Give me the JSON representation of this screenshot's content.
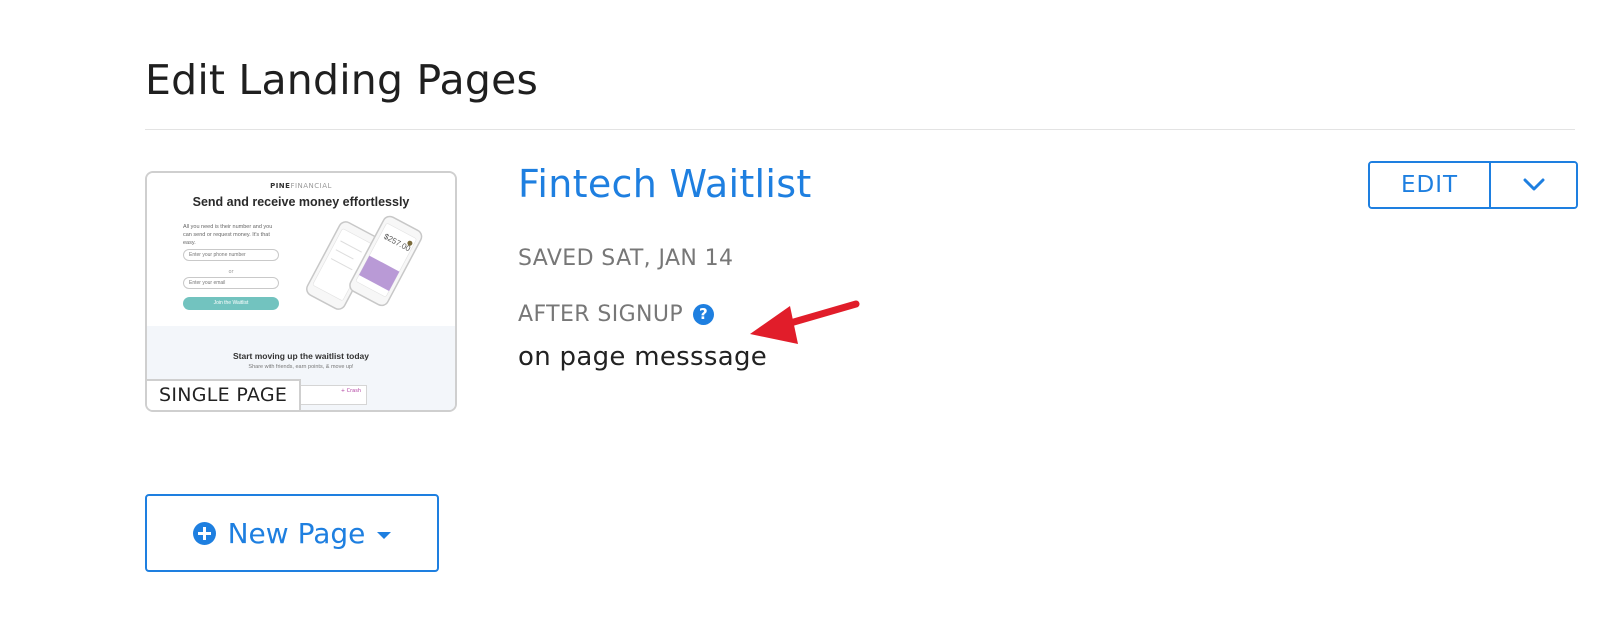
{
  "page_title": "Edit Landing Pages",
  "landing_page": {
    "name": "Fintech Waitlist",
    "saved": "SAVED SAT, JAN 14",
    "after_signup_label": "AFTER SIGNUP",
    "help_icon": "question-circle-icon",
    "after_signup_value": "on page messsage",
    "page_type_badge": "SINGLE PAGE",
    "edit_button": "EDIT",
    "dropdown_icon": "chevron-down-icon",
    "thumbnail": {
      "brand_bold": "PINE",
      "brand_light": "FINANCIAL",
      "headline": "Send and receive money effortlessly",
      "body": "All you need is their number and you can send or request money. It's that easy.",
      "phone_placeholder": "Enter your phone number",
      "or_text": "or",
      "email_placeholder": "Enter your email",
      "join_button": "Join the Waitlist",
      "amount": "$257.00",
      "section_title": "Start moving up the waitlist today",
      "section_text": "Share with friends, earn points, & move up!",
      "mini_label": "+ Crash"
    }
  },
  "new_page_button": {
    "label": "New Page",
    "icon": "plus-circle-icon",
    "caret_icon": "caret-down-icon"
  },
  "annotation": {
    "arrow_color": "#e11d2a"
  },
  "colors": {
    "accent": "#1e7fe0",
    "muted_text": "#777777",
    "thumbnail_button": "#72c3bf"
  }
}
